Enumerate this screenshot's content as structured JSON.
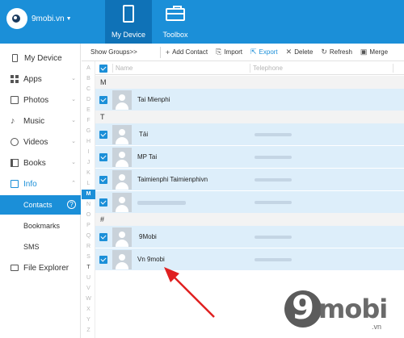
{
  "app": {
    "account_label": "9mobi.vn",
    "tabs": [
      {
        "label": "My Device"
      },
      {
        "label": "Toolbox"
      }
    ]
  },
  "sidebar": {
    "items": [
      {
        "label": "My Device"
      },
      {
        "label": "Apps"
      },
      {
        "label": "Photos"
      },
      {
        "label": "Music"
      },
      {
        "label": "Videos"
      },
      {
        "label": "Books"
      },
      {
        "label": "Info"
      },
      {
        "label": "File Explorer"
      }
    ],
    "info_subitems": [
      {
        "label": "Contacts"
      },
      {
        "label": "Bookmarks"
      },
      {
        "label": "SMS"
      }
    ],
    "help_glyph": "?"
  },
  "toolbar": {
    "show_groups": "Show Groups>>",
    "buttons": [
      {
        "label": "Add Contact",
        "icon": "+"
      },
      {
        "label": "Import",
        "icon": "⎘"
      },
      {
        "label": "Export",
        "icon": "⇱"
      },
      {
        "label": "Delete",
        "icon": "✕"
      },
      {
        "label": "Refresh",
        "icon": "↻"
      },
      {
        "label": "Merge",
        "icon": "▣"
      }
    ]
  },
  "alphabet": [
    "A",
    "B",
    "C",
    "D",
    "E",
    "F",
    "G",
    "H",
    "I",
    "J",
    "K",
    "L",
    "M",
    "N",
    "O",
    "P",
    "Q",
    "R",
    "S",
    "T",
    "U",
    "V",
    "W",
    "X",
    "Y",
    "Z"
  ],
  "alphabet_current": "M",
  "table": {
    "columns": [
      "Name",
      "Telephone"
    ],
    "groups": [
      {
        "letter": "M",
        "contacts": [
          {
            "name": "Tai Mienphi"
          }
        ]
      },
      {
        "letter": "T",
        "contacts": [
          {
            "name": "Tải"
          },
          {
            "name": "MP Tai"
          },
          {
            "name": "Taimienphi Taimienphivn"
          },
          {
            "name": ""
          }
        ]
      },
      {
        "letter": "#",
        "contacts": [
          {
            "name": "9Mobi"
          },
          {
            "name": "Vn 9mobi"
          }
        ]
      }
    ]
  },
  "watermark": {
    "mark": "9",
    "brand": "mobi",
    "domain": ".vn"
  },
  "colors": {
    "accent": "#1b8fd8",
    "selected_tab": "#0f72b7",
    "row_selected": "#ddeefa",
    "annotation": "#e02020"
  }
}
